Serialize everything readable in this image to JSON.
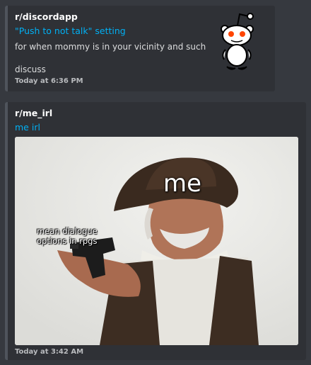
{
  "embeds": [
    {
      "author": "r/discordapp",
      "title": "\"Push to not talk\" setting",
      "description_line1": "for when mommy is in your vicinity and such",
      "description_line2": "discuss",
      "footer": "Today at 6:36 PM",
      "thumbnail": "reddit-logo-icon"
    },
    {
      "author": "r/me_irl",
      "title": "me irl",
      "image": {
        "caption_top": "me",
        "caption_side": "mean dialogue options in rpgs"
      },
      "footer": "Today at 3:42 AM"
    }
  ],
  "colors": {
    "background": "#36393f",
    "embed_background": "#2f3136",
    "embed_border": "#4f545c",
    "link": "#00b0f4"
  }
}
